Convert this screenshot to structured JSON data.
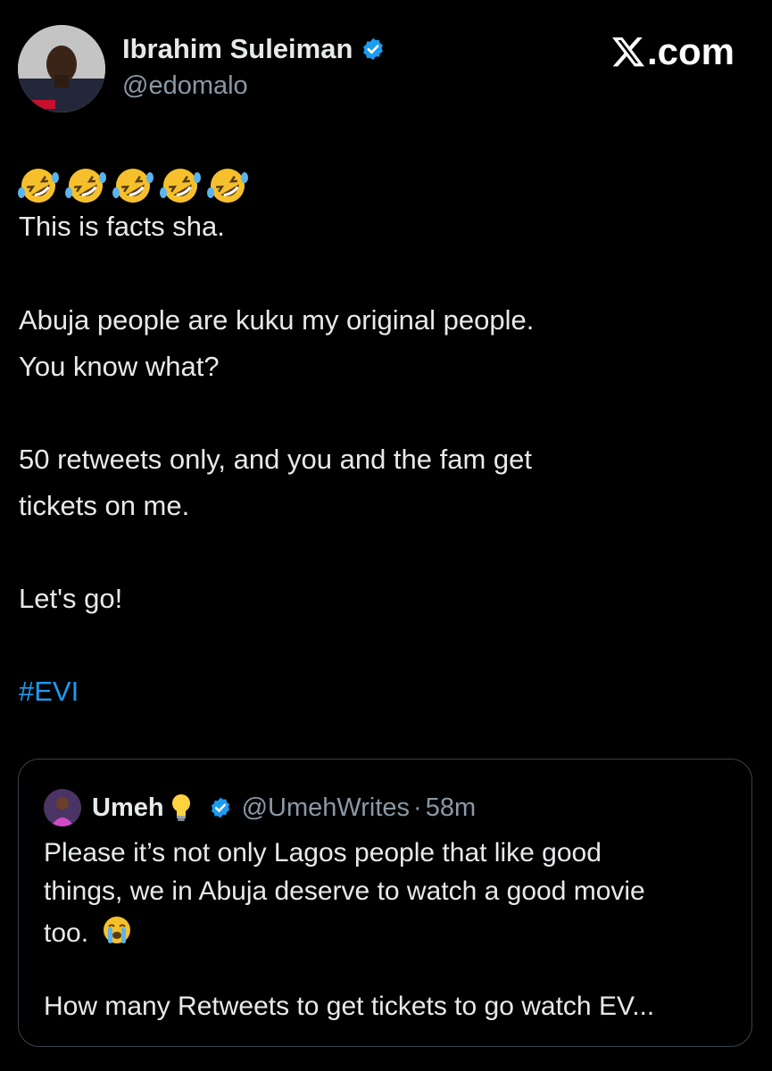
{
  "author": {
    "name": "Ibrahim Suleiman",
    "handle": "@edomalo",
    "verified": true
  },
  "brand": {
    "label": ".com",
    "icon": "x-logo-icon"
  },
  "tweet": {
    "emoji_row": [
      "rofl-emoji",
      "rofl-emoji",
      "rofl-emoji",
      "rofl-emoji",
      "rofl-emoji"
    ],
    "lines": [
      "This is facts sha.",
      "Abuja people are kuku my original people.",
      "You know what?",
      "50 retweets only, and you and the fam get",
      "tickets on me.",
      "Let's go!"
    ],
    "hashtag": "#EVI"
  },
  "quoted": {
    "name": "Umeh",
    "name_emoji": "lightbulb-emoji",
    "verified": true,
    "handle": "@UmehWrites",
    "separator": "·",
    "time": "58m",
    "lines": [
      "Please it’s not only Lagos people that like good",
      "things, we in Abuja deserve to watch a good movie",
      "too.",
      "How many Retweets to get tickets to go watch EV..."
    ],
    "line3_emoji": "crying-face-emoji"
  },
  "colors": {
    "background": "#000000",
    "text": "#e7e9ea",
    "muted": "#8b98a5",
    "link": "#1d9bf0",
    "verified": "#1d9bf0",
    "border": "#38444d"
  }
}
